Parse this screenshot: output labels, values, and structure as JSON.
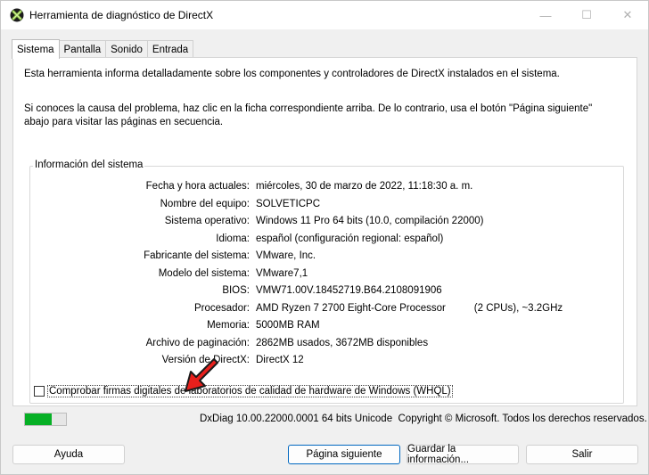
{
  "window": {
    "title": "Herramienta de diagnóstico de DirectX",
    "minimize": "—",
    "maximize": "☐",
    "close": "✕"
  },
  "tabs": [
    "Sistema",
    "Pantalla",
    "Sonido",
    "Entrada"
  ],
  "intro": {
    "line1": "Esta herramienta informa detalladamente sobre los componentes y controladores de DirectX instalados en el sistema.",
    "line2": "Si conoces la causa del problema, haz clic en la ficha correspondiente arriba. De lo contrario, usa el botón \"Página siguiente\" abajo para visitar las páginas en secuencia."
  },
  "system_info": {
    "group_title": "Información del sistema",
    "rows": [
      {
        "label": "Fecha y hora actuales:",
        "value": "miércoles, 30 de marzo de 2022, 11:18:30 a. m."
      },
      {
        "label": "Nombre del equipo:",
        "value": "SOLVETICPC"
      },
      {
        "label": "Sistema operativo:",
        "value": "Windows 11 Pro 64 bits (10.0, compilación 22000)"
      },
      {
        "label": "Idioma:",
        "value": "español (configuración regional: español)"
      },
      {
        "label": "Fabricante del sistema:",
        "value": "VMware, Inc."
      },
      {
        "label": "Modelo del sistema:",
        "value": "VMware7,1"
      },
      {
        "label": "BIOS:",
        "value": "VMW71.00V.18452719.B64.2108091906"
      },
      {
        "label": "Procesador:",
        "value": "AMD Ryzen 7 2700 Eight-Core Processor          (2 CPUs), ~3.2GHz"
      },
      {
        "label": "Memoria:",
        "value": "5000MB RAM"
      },
      {
        "label": "Archivo de paginación:",
        "value": "2862MB usados, 3672MB disponibles"
      },
      {
        "label": "Versión de DirectX:",
        "value": "DirectX 12"
      }
    ],
    "whql_label": "Comprobar firmas digitales de laboratorios de calidad de hardware de Windows (WHQL)",
    "whql_checked": false
  },
  "status": {
    "progress": 0.65,
    "copyright": "DxDiag 10.00.22000.0001 64 bits Unicode  Copyright © Microsoft. Todos los derechos reservados."
  },
  "buttons": {
    "help": "Ayuda",
    "next": "Página siguiente",
    "save": "Guardar la información...",
    "exit": "Salir"
  },
  "colors": {
    "progress": "#06b025",
    "arrow": "#e8201c",
    "primary_border": "#0067c0"
  }
}
